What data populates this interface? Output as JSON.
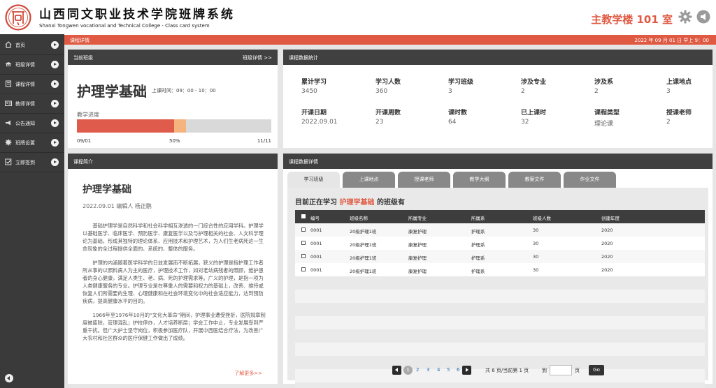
{
  "header": {
    "title_cn": "山西同文职业技术学院班牌系统",
    "title_en": "Shanxi Tongwen vocational and Technical College - Class card system",
    "classroom": "主教学楼 101 室"
  },
  "sidebar": {
    "items": [
      {
        "label": "首页",
        "icon": "home-icon"
      },
      {
        "label": "班级详情",
        "icon": "graduation-cap-icon"
      },
      {
        "label": "课程详情",
        "icon": "book-icon"
      },
      {
        "label": "教师详情",
        "icon": "id-card-icon"
      },
      {
        "label": "公告通知",
        "icon": "megaphone-icon"
      },
      {
        "label": "班牌设置",
        "icon": "gear-icon"
      },
      {
        "label": "立即签到",
        "icon": "checkbox-icon"
      }
    ]
  },
  "topbar": {
    "section": "课程详情",
    "datetime": "2022 年 09 月 01 日  早上  9：00"
  },
  "current_class": {
    "header": "当前班级",
    "details_link": "班级详情 >>",
    "course": "护理学基础",
    "time_label": "上课时间：09：00 - 10：00",
    "progress_label": "教学进度",
    "progress_fraction": 0.5,
    "progress_extra": 0.06,
    "start": "09/01",
    "mid": "50%",
    "end": "11/11"
  },
  "stats": {
    "header": "课程数据统计",
    "items": [
      {
        "label": "累计学习",
        "value": "3450"
      },
      {
        "label": "学习人数",
        "value": "360"
      },
      {
        "label": "学习班级",
        "value": "3"
      },
      {
        "label": "涉及专业",
        "value": "2"
      },
      {
        "label": "涉及系",
        "value": "2"
      },
      {
        "label": "上课地点",
        "value": "3"
      },
      {
        "label": "开课日期",
        "value": "2022.09.01"
      },
      {
        "label": "开课周数",
        "value": "23"
      },
      {
        "label": "课时数",
        "value": "64"
      },
      {
        "label": "已上课时",
        "value": "32"
      },
      {
        "label": "课程类型",
        "value": "理论课"
      },
      {
        "label": "授课老师",
        "value": "2"
      }
    ]
  },
  "intro": {
    "header": "课程简介",
    "title": "护理学基础",
    "meta": "2022.09.01   编辑人   杨正鹏",
    "paragraphs": [
      "基础护理学是自然科学和社会科学相互渗透的一门综合性的应用学科。护理学以基础医学、临床医学、预防医学、康复医学以及与护理相关的社会、人文科学理论为基础，形成其独特的理论体系、应用技术和护理艺术，为人们生老病死这一生命现象的全过程提供全面的、系统的、整体的服务。",
      "护理的内涵随着医学科学的日益发展而不断拓展，狭义的护理是指护理工作者所从事的以照料病人为主的医疗，护理技术工作，如对老幼病残者的照顾，维护患者的身心健康，满足人类生、老、病、死的护理需求等。广义的护理，是指一项为人类健康服务的专业。护理专业是在尊重人的需要和权力的基础上，改善、维持或恢复人们所需要的生理、心理健康和在社会环境变化中的社会适应能力，达到预防疾病，提高健康水平的目的。",
      "1966年至1976年10月的“文化大革命”期间，护理事业遭受挫折，医院规章制度被废除，管理混乱；护校停办，人才培养断层；学会工作中止，专业发展受到严重干扰。但广大护士坚守岗位，积极参加医疗队，开展中西医结合疗法，为改善广大农村和社区群众的医疗保健工作做出了成绩。"
    ],
    "more": "了解更多>>"
  },
  "detail": {
    "header": "课程数据详情",
    "tabs": [
      "学习班级",
      "上课地点",
      "授课老师",
      "教学大纲",
      "教案文件",
      "作业文件"
    ],
    "heading_prefix": "目前正在学习",
    "heading_course": "护理学基础",
    "heading_suffix": "的班级有",
    "columns": [
      "编号",
      "班级名称",
      "所属专业",
      "所属系",
      "班级人数",
      "创建年度"
    ],
    "rows": [
      [
        "0001",
        "20级护理1班",
        "康复护理",
        "护理系",
        "30",
        "2020"
      ],
      [
        "0001",
        "20级护理1班",
        "康复护理",
        "护理系",
        "30",
        "2020"
      ],
      [
        "0001",
        "20级护理1班",
        "康复护理",
        "护理系",
        "30",
        "2020"
      ],
      [
        "0001",
        "20级护理1班",
        "康复护理",
        "护理系",
        "30",
        "2020"
      ]
    ],
    "pager": {
      "pages": [
        "1",
        "2",
        "3",
        "4",
        "5",
        "6"
      ],
      "summary": "共 6 页/当前第 1 页",
      "goto_label": "到",
      "page_unit": "页",
      "go": "Go"
    }
  },
  "colors": {
    "accent": "#e05a43",
    "sidebar": "#3a3a3a",
    "panel_header": "#404040",
    "progress_done": "#df5b4c",
    "progress_current": "#f5b37d"
  }
}
